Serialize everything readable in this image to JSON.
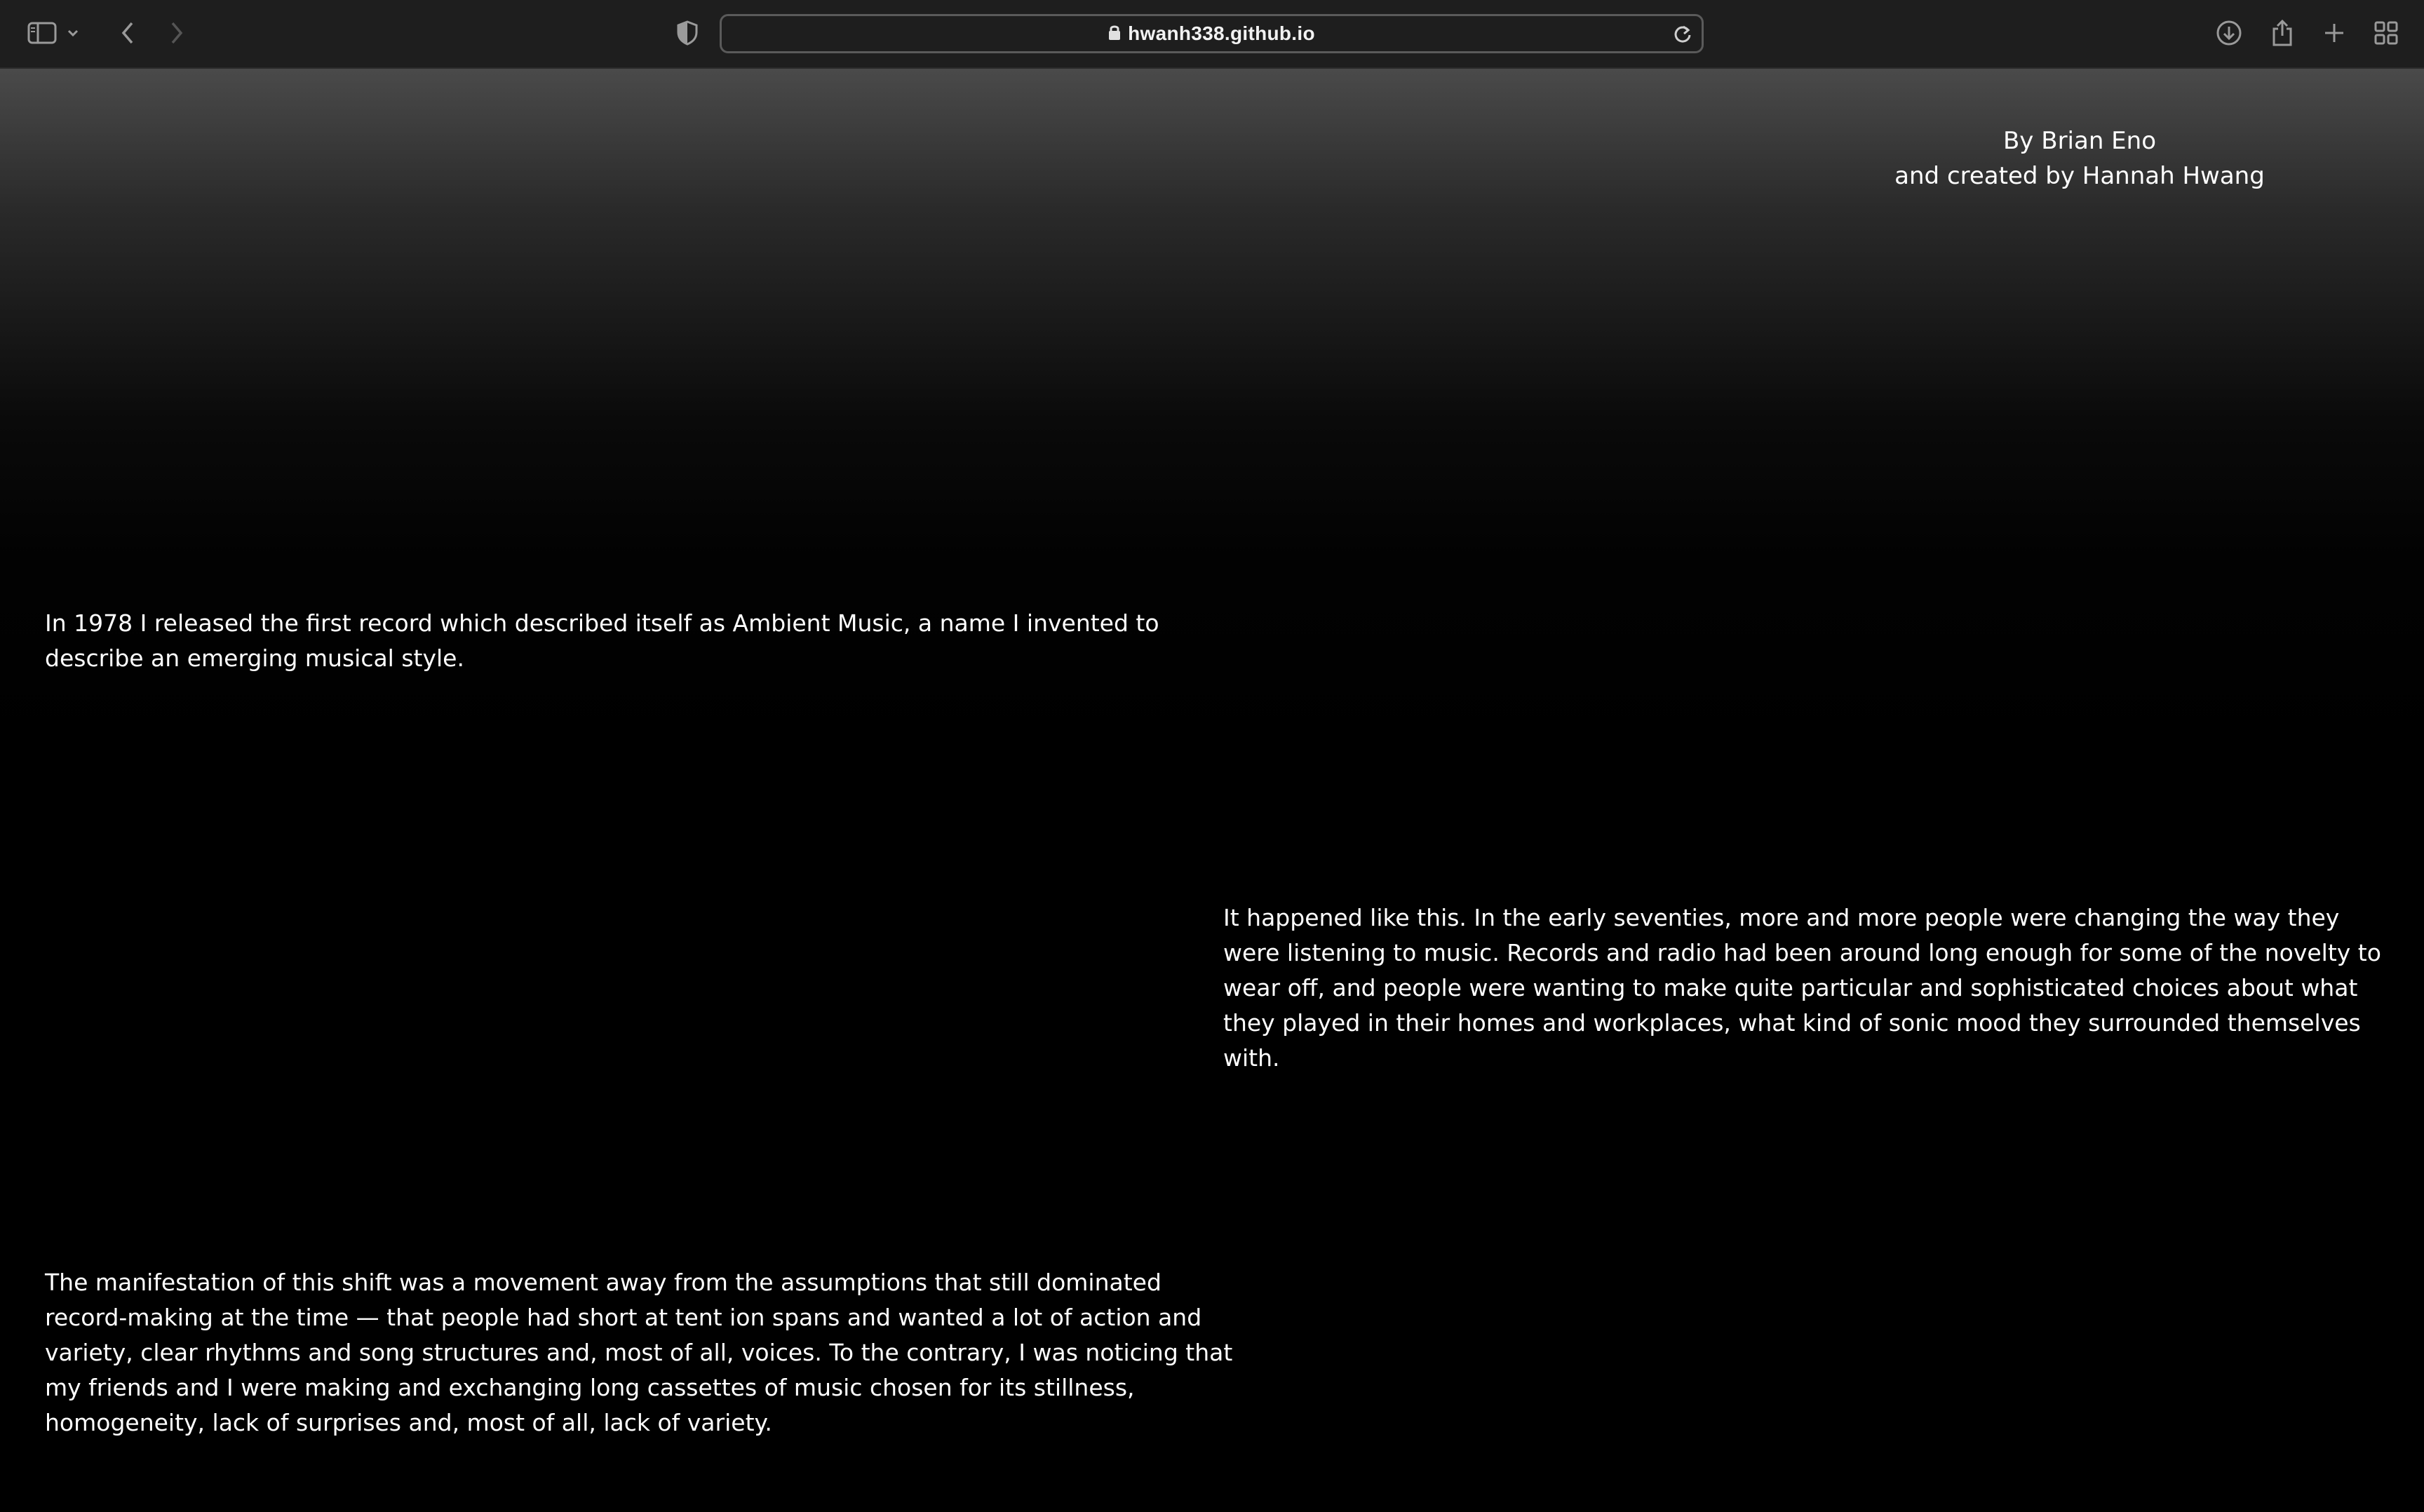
{
  "browser": {
    "url": "hwanh338.github.io",
    "icons": {
      "sidebar": "sidebar-icon",
      "sidebar_menu": "chevron-down-icon",
      "back": "chevron-left-icon",
      "forward": "chevron-right-icon",
      "privacy": "shield-icon",
      "lock": "lock-icon",
      "reload": "reload-icon",
      "downloads": "download-icon",
      "share": "share-icon",
      "new_tab": "plus-icon",
      "tab_overview": "grid-icon"
    }
  },
  "page": {
    "credit_line_1": "By Brian Eno",
    "credit_line_2": "and created by Hannah Hwang",
    "paragraphs": [
      "In 1978 I released the first record which described itself as Ambient Music, a name I invented to describe an emerging musical style.",
      "It happened like this. In the early seventies, more and more people were changing the way they were listening to music. Records and radio had been around long enough for some of the novelty to wear off, and people were wanting to make quite particular and sophisticated choices about what they played in their homes and workplaces, what kind of sonic mood they surrounded themselves with.",
      "The manifestation of this shift was a movement away from the assumptions that still dominated record-making at the time — that people had short at tent ion spans and wanted a lot of action and variety, clear rhythms and song structures and, most of all, voices. To the contrary, I was noticing that my friends and I were making and exchanging long cassettes of music chosen for its stillness, homogeneity, lack of surprises and, most of all, lack of variety."
    ]
  },
  "colors": {
    "toolbar_bg": "#1e1e1e",
    "page_bg": "#000000",
    "text": "#ffffff"
  }
}
